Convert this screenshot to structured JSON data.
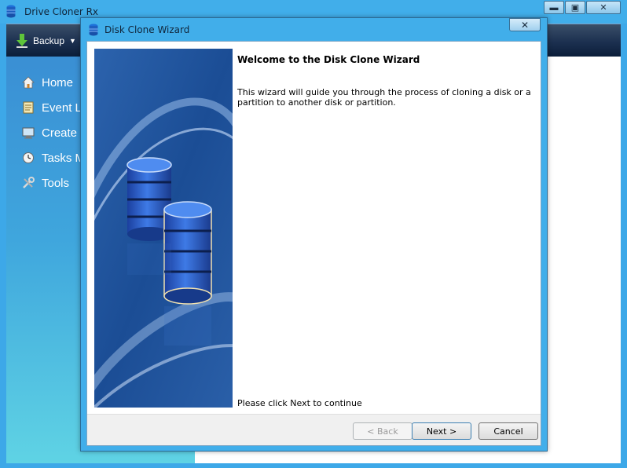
{
  "app": {
    "title": "Drive Cloner Rx",
    "toolbar": {
      "backup_label": "Backup"
    },
    "sidebar": {
      "items": [
        {
          "label": "Home",
          "icon": "home-icon"
        },
        {
          "label": "Event Lo",
          "icon": "event-log-icon"
        },
        {
          "label": "Create F",
          "icon": "create-icon"
        },
        {
          "label": "Tasks M",
          "icon": "tasks-icon"
        },
        {
          "label": "Tools",
          "icon": "tools-icon"
        }
      ]
    },
    "window_controls": {
      "minimize": "▬",
      "maximize": "▣",
      "close": "✕"
    }
  },
  "dialog": {
    "title": "Disk Clone Wizard",
    "close_glyph": "✕",
    "heading": "Welcome to the Disk Clone Wizard",
    "body": "This wizard will guide you through the process of cloning a disk or a partition to another disk or partition.",
    "continue_text": "Please click Next to continue",
    "buttons": {
      "back": "< Back",
      "next": "Next >",
      "cancel": "Cancel"
    }
  },
  "colors": {
    "title_bar": "#41aeea",
    "toolbar_dark": "#0b1e3a",
    "sidebar_top": "#3a8fd4",
    "sidebar_bottom": "#5fd3e4",
    "image_blue": "#1c4f9a"
  }
}
